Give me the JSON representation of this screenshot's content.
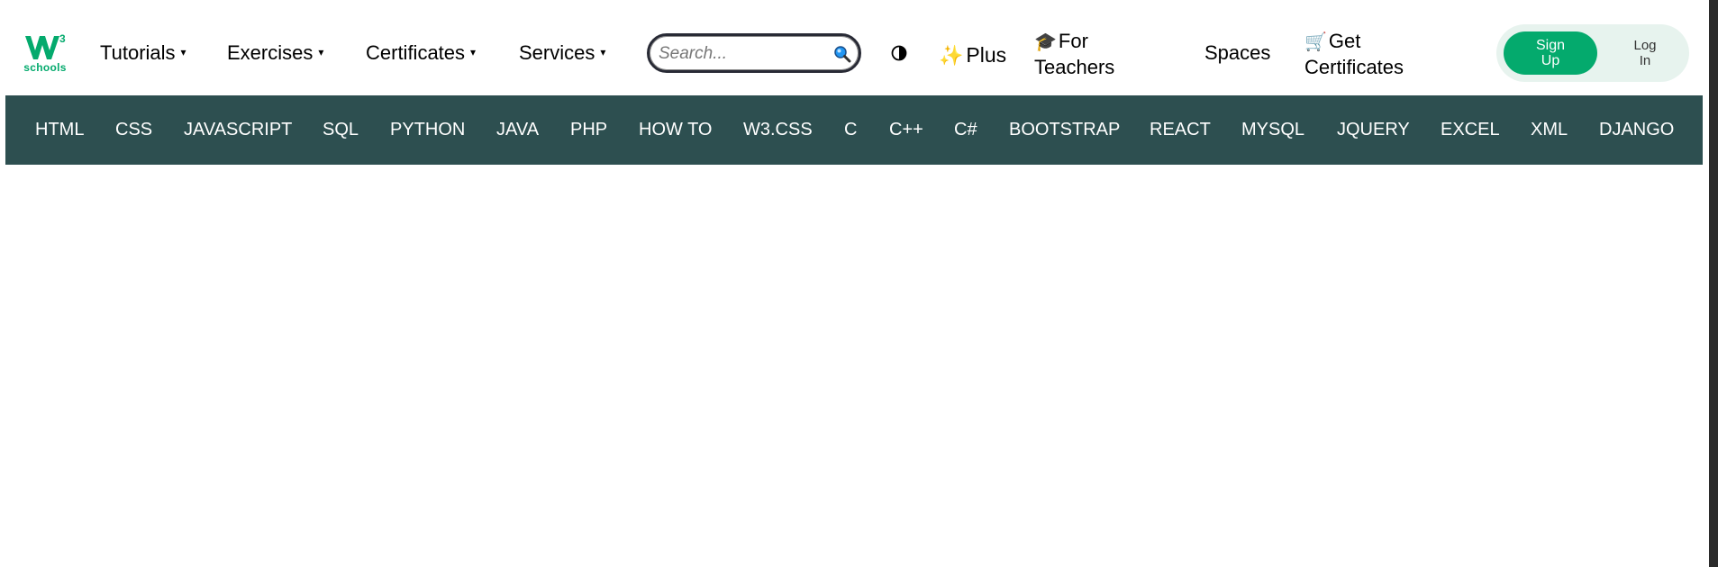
{
  "brand": {
    "logo_text": "schools",
    "logo_color": "#04AA6D"
  },
  "nav": {
    "tutorials": "Tutorials",
    "exercises": "Exercises",
    "certificates": "Certificates",
    "services": "Services",
    "caret": "▾"
  },
  "search": {
    "placeholder": "Search...",
    "icon": "search-icon"
  },
  "contrast": {
    "icon": "contrast-toggle-icon"
  },
  "plus": {
    "icon": "sparkles-icon",
    "icon_glyph": "✨",
    "label": "Plus"
  },
  "teachers": {
    "icon": "graduation-cap-icon",
    "icon_glyph": "🎓",
    "line1": "For",
    "line2": "Teachers"
  },
  "spaces": {
    "label": "Spaces"
  },
  "get_certificates": {
    "icon": "cart-icon",
    "icon_glyph": "🛒",
    "line1": "Get",
    "line2": "Certificates"
  },
  "auth": {
    "signup_label": "Sign\nUp",
    "login_label": "Log\nIn",
    "signup_color": "#04AA6D",
    "pill_color": "#E7F3EE"
  },
  "subnav": {
    "background": "#2D4F50",
    "items": [
      "HTML",
      "CSS",
      "JAVASCRIPT",
      "SQL",
      "PYTHON",
      "JAVA",
      "PHP",
      "HOW TO",
      "W3.CSS",
      "C",
      "C++",
      "C#",
      "BOOTSTRAP",
      "REACT",
      "MYSQL",
      "JQUERY",
      "EXCEL",
      "XML",
      "DJANGO"
    ]
  }
}
